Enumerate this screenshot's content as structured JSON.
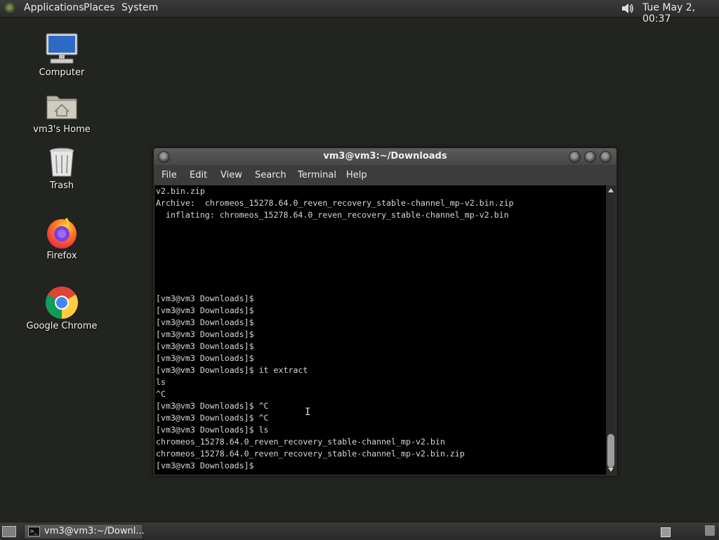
{
  "top_panel": {
    "menus": [
      "Applications",
      "Places",
      "System"
    ],
    "clock": "Tue May  2, 00:37",
    "volume_icon": "speaker-icon"
  },
  "desktop": {
    "icons": [
      {
        "label": "Computer",
        "icon": "computer-icon"
      },
      {
        "label": "vm3's Home",
        "icon": "home-folder-icon"
      },
      {
        "label": "Trash",
        "icon": "trash-icon"
      },
      {
        "label": "Firefox",
        "icon": "firefox-icon"
      },
      {
        "label": "Google Chrome",
        "icon": "chrome-icon"
      }
    ]
  },
  "window": {
    "title": "vm3@vm3:~/Downloads",
    "menu": [
      "File",
      "Edit",
      "View",
      "Search",
      "Terminal",
      "Help"
    ],
    "lines": [
      "v2.bin.zip",
      "Archive:  chromeos_15278.64.0_reven_recovery_stable-channel_mp-v2.bin.zip",
      "  inflating: chromeos_15278.64.0_reven_recovery_stable-channel_mp-v2.bin",
      "",
      "",
      "",
      "",
      "",
      "",
      "[vm3@vm3 Downloads]$",
      "[vm3@vm3 Downloads]$",
      "[vm3@vm3 Downloads]$",
      "[vm3@vm3 Downloads]$",
      "[vm3@vm3 Downloads]$",
      "[vm3@vm3 Downloads]$",
      "[vm3@vm3 Downloads]$ it extract",
      "ls",
      "^C",
      "[vm3@vm3 Downloads]$ ^C",
      "[vm3@vm3 Downloads]$ ^C",
      "[vm3@vm3 Downloads]$ ls",
      "chromeos_15278.64.0_reven_recovery_stable-channel_mp-v2.bin",
      "chromeos_15278.64.0_reven_recovery_stable-channel_mp-v2.bin.zip",
      "[vm3@vm3 Downloads]$"
    ]
  },
  "taskbar": {
    "task_label": "vm3@vm3:~/Downl..."
  },
  "colors": {
    "desktop_bg": "#22241f",
    "terminal_bg": "#000000",
    "terminal_fg": "#d8d8d8"
  }
}
